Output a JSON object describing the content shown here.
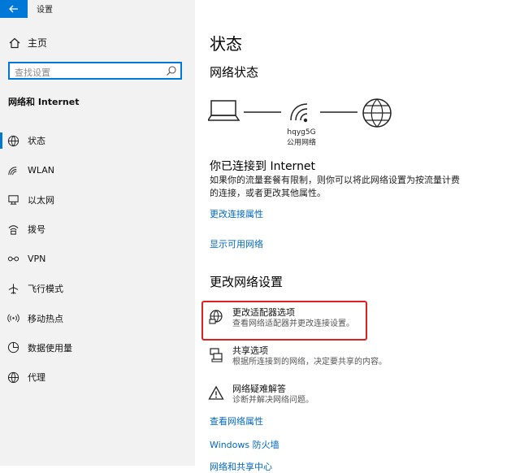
{
  "window": {
    "title": "设置"
  },
  "sidebar": {
    "home_label": "主页",
    "search_placeholder": "查找设置",
    "section_label": "网络和 Internet",
    "items": [
      {
        "label": "状态",
        "icon": "status-icon",
        "active": true
      },
      {
        "label": "WLAN",
        "icon": "wifi-icon"
      },
      {
        "label": "以太网",
        "icon": "ethernet-icon"
      },
      {
        "label": "拨号",
        "icon": "dialup-icon"
      },
      {
        "label": "VPN",
        "icon": "vpn-icon"
      },
      {
        "label": "飞行模式",
        "icon": "airplane-icon"
      },
      {
        "label": "移动热点",
        "icon": "hotspot-icon"
      },
      {
        "label": "数据使用量",
        "icon": "data-usage-icon"
      },
      {
        "label": "代理",
        "icon": "globe-icon"
      }
    ]
  },
  "main": {
    "title": "状态",
    "network_status_heading": "网络状态",
    "network_name": "hqyg5G",
    "network_type": "公用网络",
    "connected_heading": "你已连接到 Internet",
    "connected_desc": "如果你的流量套餐有限制，则你可以将此网络设置为按流量计费的连接，或者更改其他属性。",
    "link_change_props": "更改连接属性",
    "link_show_networks": "显示可用网络",
    "change_settings_heading": "更改网络设置",
    "options": [
      {
        "title": "更改适配器选项",
        "subtitle": "查看网络适配器并更改连接设置。",
        "icon": "adapter-icon"
      },
      {
        "title": "共享选项",
        "subtitle": "根据所连接到的网络，决定要共享的内容。",
        "icon": "sharing-icon"
      },
      {
        "title": "网络疑难解答",
        "subtitle": "诊断并解决网络问题。",
        "icon": "warning-icon"
      }
    ],
    "link_view_props": "查看网络属性",
    "link_firewall": "Windows 防火墙",
    "link_partial": "网络和共享中心"
  },
  "colors": {
    "accent": "#0078d7",
    "link": "#0067c0",
    "highlight": "#e02020"
  }
}
